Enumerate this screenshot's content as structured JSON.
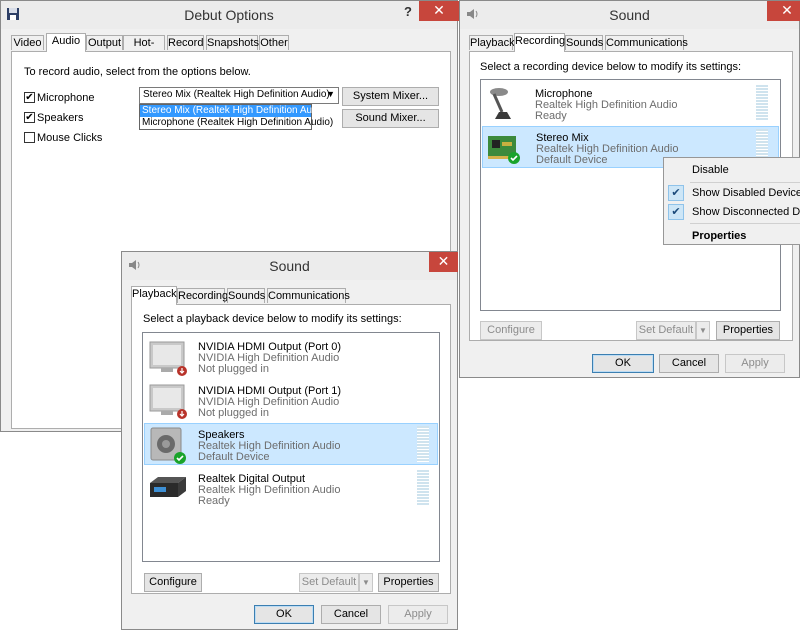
{
  "debut": {
    "title": "Debut Options",
    "help": "?",
    "close": "✕",
    "tabs": [
      "Video",
      "Audio",
      "Output",
      "Hot-Keys",
      "Record",
      "Snapshots",
      "Other"
    ],
    "active_tab": "Audio",
    "instruction": "To record audio, select from the options below.",
    "microphone_label": "Microphone",
    "speakers_label": "Speakers",
    "mouse_clicks_label": "Mouse Clicks",
    "microphone_checked": true,
    "speakers_checked": true,
    "mouse_clicks_checked": false,
    "source_value": "Stereo Mix (Realtek High Definition Audio)",
    "source_options": [
      "Stereo Mix (Realtek High Definition Audio)",
      "Microphone (Realtek High Definition Audio)"
    ],
    "system_mixer": "System Mixer...",
    "sound_mixer": "Sound Mixer..."
  },
  "recording": {
    "title": "Sound",
    "close": "✕",
    "tabs": [
      "Playback",
      "Recording",
      "Sounds",
      "Communications"
    ],
    "active_tab": "Recording",
    "instruction": "Select a recording device below to modify its settings:",
    "devices": [
      {
        "name": "Microphone",
        "driver": "Realtek High Definition Audio",
        "status": "Ready"
      },
      {
        "name": "Stereo Mix",
        "driver": "Realtek High Definition Audio",
        "status": "Default Device"
      }
    ],
    "configure": "Configure",
    "set_default": "Set Default",
    "properties": "Properties",
    "ok": "OK",
    "cancel": "Cancel",
    "apply": "Apply"
  },
  "context_menu": {
    "items": [
      "Disable",
      "Show Disabled Devices",
      "Show Disconnected Devi",
      "Properties"
    ]
  },
  "playback": {
    "title": "Sound",
    "close": "✕",
    "tabs": [
      "Playback",
      "Recording",
      "Sounds",
      "Communications"
    ],
    "active_tab": "Playback",
    "instruction": "Select a playback device below to modify its settings:",
    "devices": [
      {
        "name": "NVIDIA HDMI Output (Port 0)",
        "driver": "NVIDIA High Definition Audio",
        "status": "Not plugged in"
      },
      {
        "name": "NVIDIA HDMI Output (Port 1)",
        "driver": "NVIDIA High Definition Audio",
        "status": "Not plugged in"
      },
      {
        "name": "Speakers",
        "driver": "Realtek High Definition Audio",
        "status": "Default Device"
      },
      {
        "name": "Realtek Digital Output",
        "driver": "Realtek High Definition Audio",
        "status": "Ready"
      }
    ],
    "configure": "Configure",
    "set_default": "Set Default",
    "properties": "Properties",
    "ok": "OK",
    "cancel": "Cancel",
    "apply": "Apply"
  },
  "colors": {
    "close": "#c7463c",
    "selection": "#cce8ff",
    "dropdown_highlight": "#3399ff",
    "check": "#1aa32a"
  }
}
